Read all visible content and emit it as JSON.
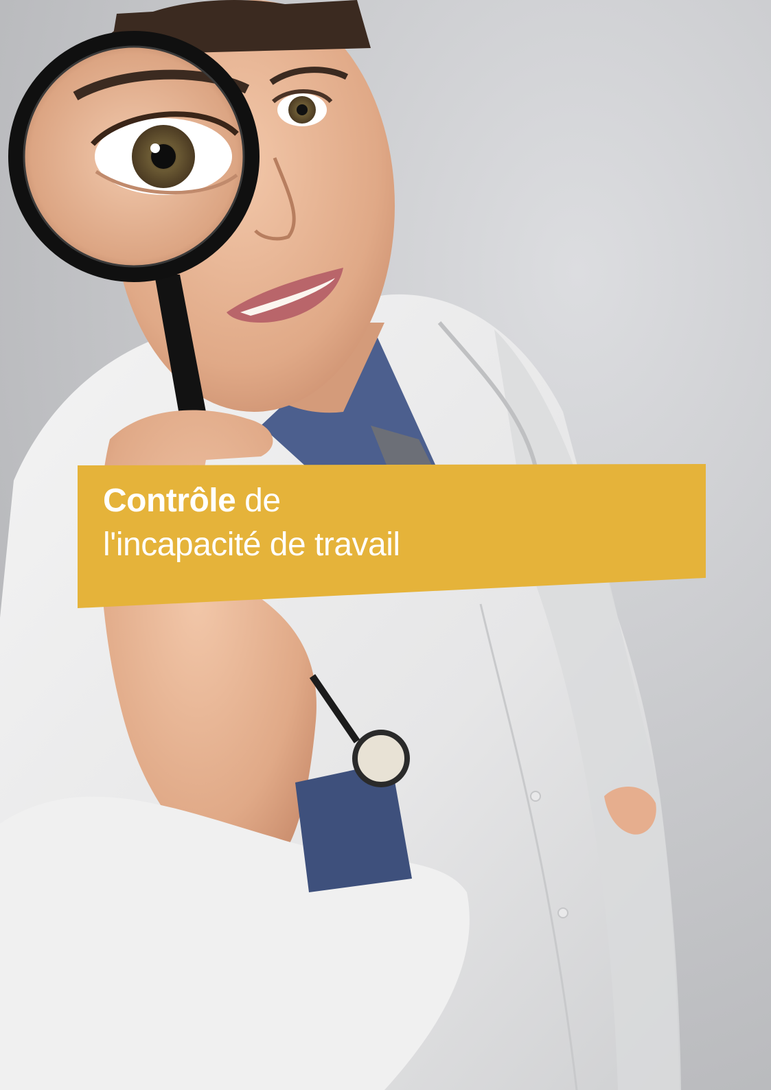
{
  "cover": {
    "title_bold": "Contrôle",
    "title_light_1": " de",
    "title_line_2": "l'incapacité de travail",
    "banner_color": "#e5b33a",
    "text_color": "#ffffff"
  },
  "photo": {
    "subject": "doctor-with-magnifying-glass"
  }
}
